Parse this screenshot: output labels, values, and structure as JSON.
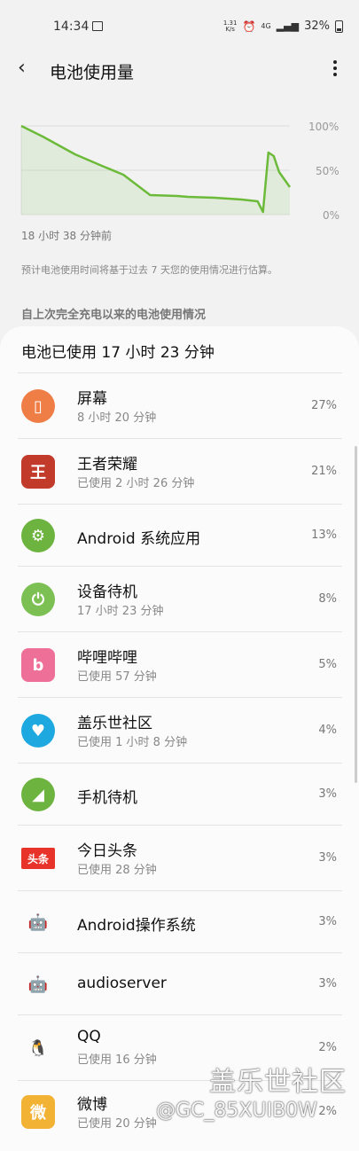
{
  "status_bar": {
    "time": "14:34",
    "speed_top": "1.31",
    "speed_bottom": "K/s",
    "net": "4G",
    "battery": "32%"
  },
  "header": {
    "title": "电池使用量"
  },
  "chart_data": {
    "type": "line",
    "y_ticks": [
      "100%",
      "50%",
      "0%"
    ],
    "ylim": [
      0,
      100
    ],
    "x_start_label": "18 小时 38 分钟前",
    "x": [
      0,
      8,
      20,
      30,
      38,
      48,
      58,
      62,
      72,
      82,
      88,
      90,
      92,
      94,
      96,
      100
    ],
    "values": [
      100,
      88,
      68,
      55,
      45,
      22,
      21,
      20,
      19,
      17,
      15,
      3,
      70,
      66,
      48,
      31
    ],
    "color": "#6cba3a"
  },
  "note": "预计电池使用时间将基于过去 7 天您的使用情况进行估算。",
  "section_title": "自上次完全充电以来的电池使用情况",
  "card_title": "电池已使用 17 小时 23 分钟",
  "rows": [
    {
      "name": "屏幕",
      "sub": "8 小时 20 分钟",
      "pct": "27%",
      "icon": "screen-icon",
      "color": "#ef7d46"
    },
    {
      "name": "王者荣耀",
      "sub": "已使用 2 小时 26 分钟",
      "pct": "21%",
      "icon": "honor-of-kings-icon",
      "color": "#c23a2a"
    },
    {
      "name": "Android 系统应用",
      "sub": "",
      "pct": "13%",
      "icon": "gear-icon",
      "color": "#6db33f"
    },
    {
      "name": "设备待机",
      "sub": "17 小时 23 分钟",
      "pct": "8%",
      "icon": "power-icon",
      "color": "#7cc054"
    },
    {
      "name": "哔哩哔哩",
      "sub": "已使用 57 分钟",
      "pct": "5%",
      "icon": "bilibili-icon",
      "color": "#ee6f97"
    },
    {
      "name": "盖乐世社区",
      "sub": "已使用 1 小时 8 分钟",
      "pct": "4%",
      "icon": "galaxy-community-icon",
      "color": "#1ea8e0"
    },
    {
      "name": "手机待机",
      "sub": "",
      "pct": "3%",
      "icon": "signal-icon",
      "color": "#6db33f"
    },
    {
      "name": "今日头条",
      "sub": "已使用 28 分钟",
      "pct": "3%",
      "icon": "toutiao-icon",
      "color": "#e8332a"
    },
    {
      "name": "Android操作系统",
      "sub": "",
      "pct": "3%",
      "icon": "android-icon",
      "color": "#40a9e0"
    },
    {
      "name": "audioserver",
      "sub": "",
      "pct": "3%",
      "icon": "android-icon",
      "color": "#40a9e0"
    },
    {
      "name": "QQ",
      "sub": "已使用 16 分钟",
      "pct": "2%",
      "icon": "qq-icon",
      "color": "#111111"
    },
    {
      "name": "微博",
      "sub": "已使用 20 分钟",
      "pct": "2%",
      "icon": "weibo-icon",
      "color": "#f2b233"
    }
  ],
  "watermark": {
    "brand": "盖乐世社区",
    "user": "@GC_85XUIB0W"
  }
}
